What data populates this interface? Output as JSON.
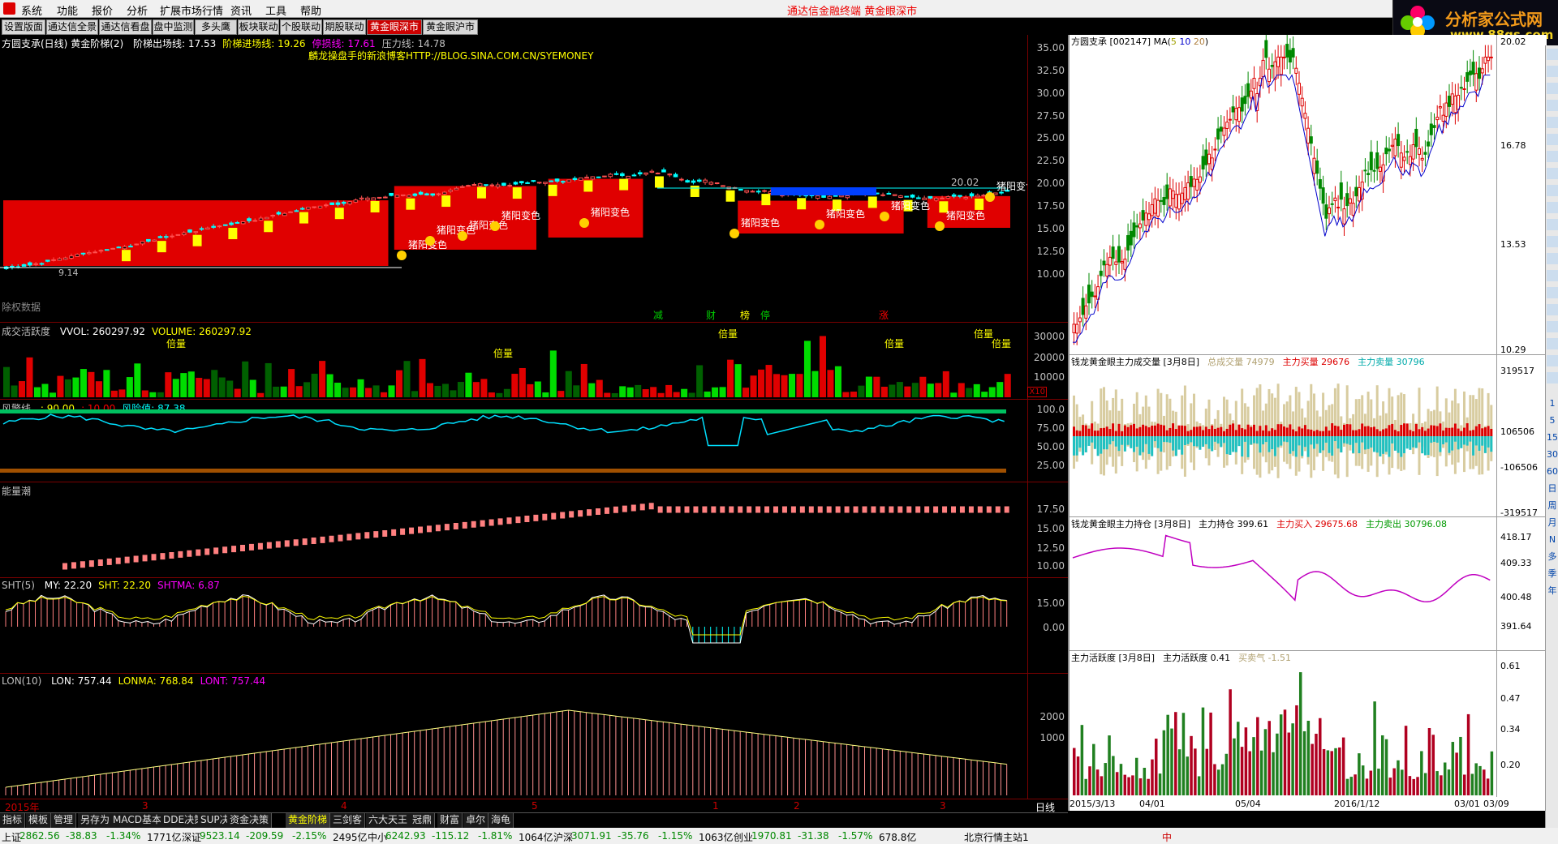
{
  "menu": {
    "items": [
      "系统",
      "功能",
      "报价",
      "分析",
      "扩展市场行情",
      "资讯",
      "工具",
      "帮助"
    ],
    "center": "通达信金融终端   黄金眼深市"
  },
  "brand": {
    "line1": "分析家公式网",
    "line2": "www.88gs.com"
  },
  "page_tabs": [
    {
      "label": "设置版面",
      "active": false
    },
    {
      "label": "通达信全景",
      "active": false
    },
    {
      "label": "通达信看盘",
      "active": false
    },
    {
      "label": "盘中监测",
      "active": false
    },
    {
      "label": "多头鹰",
      "active": false
    },
    {
      "label": "板块联动",
      "active": false
    },
    {
      "label": "个股联动",
      "active": false
    },
    {
      "label": "期股联动",
      "active": false
    },
    {
      "label": "黄金眼深市",
      "active": true
    },
    {
      "label": "黄金眼沪市",
      "active": false
    }
  ],
  "main": {
    "title": "方圆支承(日线)",
    "indicator": "黄金阶梯(2)",
    "values": [
      {
        "label": "阶梯出场线:",
        "value": "17.53",
        "color": "#ffffff"
      },
      {
        "label": "阶梯进场线:",
        "value": "19.26",
        "color": "#ffff00"
      },
      {
        "label": "停损线:",
        "value": "17.61",
        "color": "#ff00ff"
      },
      {
        "label": "压力线:",
        "value": "14.78",
        "color": "#c0c0c0"
      }
    ],
    "blog": "麟龙操盘手的新浪博客HTTP://BLOG.SINA.COM.CN/SYEMONEY",
    "ticks": [
      "35.00",
      "32.50",
      "30.00",
      "27.50",
      "25.00",
      "22.50",
      "20.00",
      "17.50",
      "15.00",
      "12.50",
      "10.00"
    ],
    "price_label": "20.02",
    "low_label": "9.14",
    "signal": "猪阳变色",
    "bottom_markers": [
      "减",
      "财",
      "榜",
      "停",
      "涨"
    ],
    "bottom_left": "除权数据"
  },
  "vol": {
    "title": "成交活跃度",
    "values": [
      {
        "label": "VVOL:",
        "value": "260297.92",
        "color": "#ffffff"
      },
      {
        "label": "VOLUME:",
        "value": "260297.92",
        "color": "#ffff00"
      }
    ],
    "ticks": [
      "30000",
      "20000",
      "10000"
    ],
    "unit": "X10",
    "mark": "倍量"
  },
  "risk": {
    "title": "风警线",
    "values": [
      {
        "label": ":",
        "value": "90.00",
        "color": "#ffff00"
      },
      {
        "label": ":",
        "value": "10.00",
        "color": "#ff0000"
      },
      {
        "label": "风险值:",
        "value": "87.38",
        "color": "#00ffff"
      }
    ],
    "ticks": [
      "100.0",
      "75.00",
      "50.00",
      "25.00"
    ]
  },
  "energy": {
    "title": "能量潮",
    "ticks": [
      "17.50",
      "15.00",
      "12.50",
      "10.00"
    ]
  },
  "sht": {
    "title": "SHT(5)",
    "values": [
      {
        "label": "MY:",
        "value": "22.20",
        "color": "#ffffff"
      },
      {
        "label": "SHT:",
        "value": "22.20",
        "color": "#ffff00"
      },
      {
        "label": "SHTMA:",
        "value": "6.87",
        "color": "#ff00ff"
      }
    ],
    "ticks": [
      "15.00",
      "0.00"
    ]
  },
  "lon": {
    "title": "LON(10)",
    "values": [
      {
        "label": "LON:",
        "value": "757.44",
        "color": "#ffffff"
      },
      {
        "label": "LONMA:",
        "value": "768.84",
        "color": "#ffff00"
      },
      {
        "label": "LONT:",
        "value": "757.44",
        "color": "#ff00ff"
      }
    ],
    "ticks": [
      "2000",
      "1000"
    ]
  },
  "dates": {
    "labels": [
      "2015年",
      "3",
      "4",
      "5",
      "1",
      "2",
      "3"
    ],
    "right": "日线"
  },
  "indicator_tabs": [
    {
      "label": "指标",
      "active": false
    },
    {
      "label": "模板",
      "active": false
    },
    {
      "label": "管理",
      "active": false
    },
    {
      "label": "另存为",
      "active": false
    },
    {
      "label": "MACD基本",
      "active": false
    },
    {
      "label": "DDE决策",
      "active": false
    },
    {
      "label": "SUP决策",
      "active": false
    },
    {
      "label": "资金决策",
      "active": false
    },
    {
      "label": "黄金阶梯",
      "active": true
    },
    {
      "label": "三剑客",
      "active": false
    },
    {
      "label": "六大天王",
      "active": false
    },
    {
      "label": "冠鼎",
      "active": false
    },
    {
      "label": "财富",
      "active": false
    },
    {
      "label": "卓尔",
      "active": false
    },
    {
      "label": "海龟",
      "active": false
    }
  ],
  "right": {
    "kline": {
      "title": "方圆支承",
      "code": "[002147]",
      "ma": "MA(",
      "ma1": "5",
      "ma2": "10",
      "ma3": "20",
      "ma_end": ")",
      "ticks": [
        "20.02",
        "16.78",
        "13.53",
        "10.29"
      ]
    },
    "vol": {
      "title": "钱龙黄金眼主力成交量 [3月8日]",
      "items": [
        {
          "label": "总成交量",
          "value": "74979",
          "color": "#b0a070"
        },
        {
          "label": "主力买量",
          "value": "29676",
          "color": "#dd0000"
        },
        {
          "label": "主力卖量",
          "value": "30796",
          "color": "#00aaaa"
        }
      ],
      "ticks": [
        "319517",
        "106506",
        "-106506",
        "-319517"
      ]
    },
    "hold": {
      "title": "钱龙黄金眼主力持仓 [3月8日]",
      "items": [
        {
          "label": "主力持仓",
          "value": "399.61",
          "color": "#000000"
        },
        {
          "label": "主力买入",
          "value": "29675.68",
          "color": "#dd0000"
        },
        {
          "label": "主力卖出",
          "value": "30796.08",
          "color": "#009900"
        }
      ],
      "ticks": [
        "418.17",
        "409.33",
        "400.48",
        "391.64"
      ]
    },
    "act": {
      "title": "主力活跃度 [3月8日]",
      "items": [
        {
          "label": "主力活跃度",
          "value": "0.41",
          "color": "#000000"
        },
        {
          "label": "买卖气",
          "value": "-1.51",
          "color": "#b0a070"
        }
      ],
      "ticks": [
        "0.61",
        "0.47",
        "0.34",
        "0.20"
      ]
    },
    "dates": [
      "2015/3/13",
      "04/01",
      "05/04",
      "2016/1/12",
      "03/01",
      "03/09"
    ]
  },
  "toolbar_labels": [
    "1",
    "5",
    "15",
    "30",
    "60",
    "日",
    "周",
    "月",
    "N",
    "多",
    "季",
    "年"
  ],
  "status": [
    {
      "text": "上证",
      "color": "#000"
    },
    {
      "text": "2862.56",
      "color": "#008800"
    },
    {
      "text": "-38.83",
      "color": "#008800"
    },
    {
      "text": "-1.34%",
      "color": "#008800"
    },
    {
      "text": "1771亿",
      "color": "#000"
    },
    {
      "text": "深证",
      "color": "#000"
    },
    {
      "text": "9523.14",
      "color": "#008800"
    },
    {
      "text": "-209.59",
      "color": "#008800"
    },
    {
      "text": "-2.15%",
      "color": "#008800"
    },
    {
      "text": "2495亿",
      "color": "#000"
    },
    {
      "text": "中小",
      "color": "#000"
    },
    {
      "text": "6242.93",
      "color": "#008800"
    },
    {
      "text": "-115.12",
      "color": "#008800"
    },
    {
      "text": "-1.81%",
      "color": "#008800"
    },
    {
      "text": "1064亿",
      "color": "#000"
    },
    {
      "text": "沪深",
      "color": "#000"
    },
    {
      "text": "3071.91",
      "color": "#008800"
    },
    {
      "text": "-35.76",
      "color": "#008800"
    },
    {
      "text": "-1.15%",
      "color": "#008800"
    },
    {
      "text": "1063亿",
      "color": "#000"
    },
    {
      "text": "创业",
      "color": "#000"
    },
    {
      "text": "1970.81",
      "color": "#008800"
    },
    {
      "text": "-31.38",
      "color": "#008800"
    },
    {
      "text": "-1.57%",
      "color": "#008800"
    },
    {
      "text": "678.8亿",
      "color": "#000"
    }
  ],
  "status_right": "北京行情主站1",
  "ime": "中"
}
